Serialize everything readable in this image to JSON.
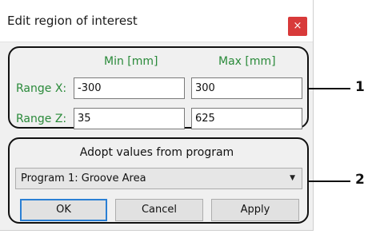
{
  "window": {
    "title": "Edit region of interest",
    "close_glyph": "×",
    "close_color": "#d83a3a"
  },
  "ranges": {
    "col_min": "Min [mm]",
    "col_max": "Max [mm]",
    "label_color": "#2a8a3a",
    "rows": [
      {
        "label": "Range X:",
        "min": "-300",
        "max": "300"
      },
      {
        "label": "Range Z:",
        "min": "35",
        "max": "625"
      }
    ]
  },
  "adopt": {
    "label": "Adopt values from program",
    "selected_program": "Program 1: Groove Area"
  },
  "buttons": {
    "ok": "OK",
    "cancel": "Cancel",
    "apply": "Apply"
  },
  "callouts": [
    "1",
    "2"
  ]
}
